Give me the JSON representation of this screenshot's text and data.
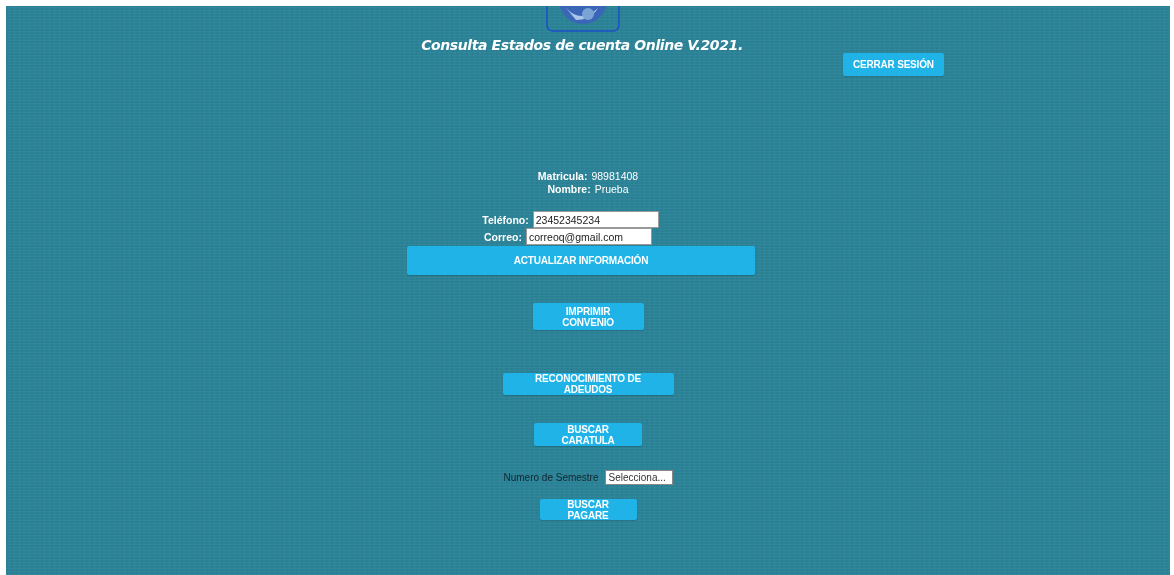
{
  "header": {
    "title": "Consulta Estados de cuenta Online V.2021.",
    "logout_button": "CERRAR SESIÓN"
  },
  "info": [
    {
      "label": "Matricula:",
      "value": "98981408"
    },
    {
      "label": "Nombre:",
      "value": "Prueba"
    }
  ],
  "fields": [
    {
      "label": "Teléfono:",
      "value": "23452345234"
    },
    {
      "label": "Correo:",
      "value": "correoq@gmail.com"
    }
  ],
  "update_button": "ACTUALIZAR INFORMACIÓN",
  "actions": [
    "IMPRIMIR CONVENIO",
    "RECONOCIMIENTO DE ADEUDOS",
    "BUSCAR CARATULA"
  ],
  "semester": {
    "label": "Numero de Semestre",
    "value": "Selecciona..."
  },
  "pagare_button": "BUSCAR PAGARE"
}
